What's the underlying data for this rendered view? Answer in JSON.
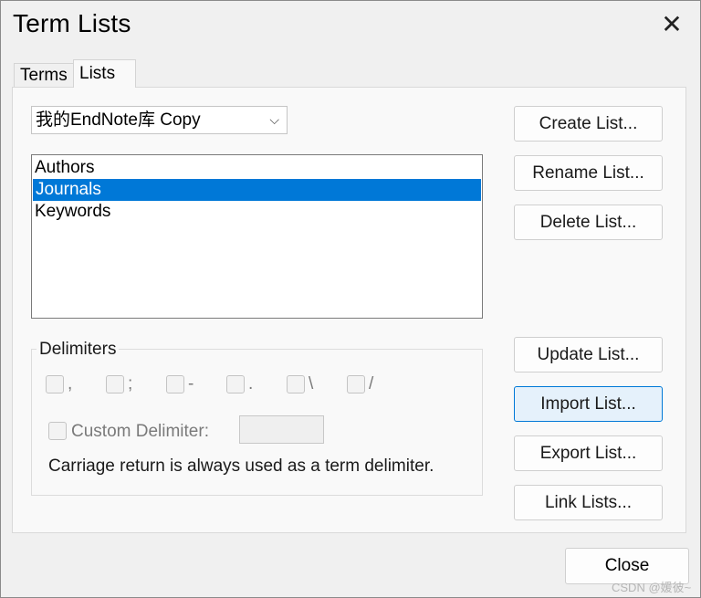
{
  "window": {
    "title": "Term Lists",
    "close_glyph": "✕"
  },
  "tabs": [
    {
      "label": "Terms",
      "active": false
    },
    {
      "label": "Lists",
      "active": true
    }
  ],
  "library_select": {
    "value": "我的EndNote库 Copy",
    "chevron": "⌵"
  },
  "lists": [
    {
      "label": "Authors",
      "selected": false
    },
    {
      "label": "Journals",
      "selected": true
    },
    {
      "label": "Keywords",
      "selected": false
    }
  ],
  "buttons": {
    "create": "Create List...",
    "rename": "Rename List...",
    "delete": "Delete List...",
    "update": "Update List...",
    "import": "Import List...",
    "export": "Export List...",
    "link": "Link Lists..."
  },
  "delimiters": {
    "legend": "Delimiters",
    "options": [
      ",",
      ";",
      "-",
      ".",
      "\\",
      "/"
    ],
    "custom_label": "Custom Delimiter:",
    "custom_value": "",
    "note": "Carriage return is always used as a term delimiter."
  },
  "footer": {
    "close": "Close",
    "watermark": "CSDN @媛彼~"
  },
  "colors": {
    "selection": "#0078d7",
    "focus_button_bg": "#e5f1fb"
  }
}
